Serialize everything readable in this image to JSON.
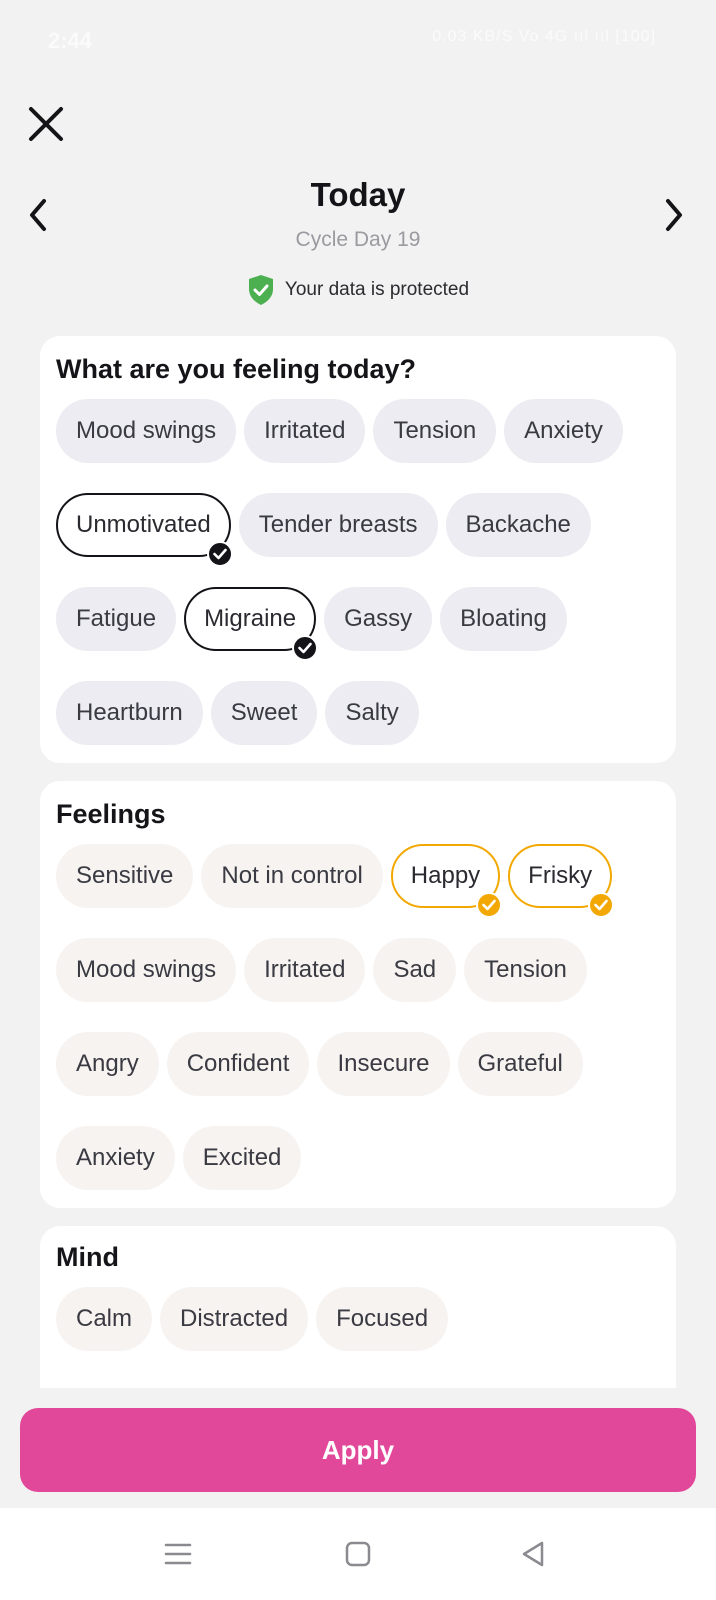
{
  "status_bar": {
    "time": "2:44",
    "icons_text": "0.03 KB/S  Vo  4G  ııl  ııl  [100]"
  },
  "header": {
    "title": "Today",
    "subtitle": "Cycle Day 19",
    "protected_text": "Your data is protected"
  },
  "symptoms": {
    "title": "What are you feeling today?",
    "chips": [
      {
        "label": "Mood swings",
        "selected": false
      },
      {
        "label": "Irritated",
        "selected": false
      },
      {
        "label": "Tension",
        "selected": false
      },
      {
        "label": "Anxiety",
        "selected": false
      },
      {
        "label": "Unmotivated",
        "selected": true
      },
      {
        "label": "Tender breasts",
        "selected": false
      },
      {
        "label": "Backache",
        "selected": false
      },
      {
        "label": "Fatigue",
        "selected": false
      },
      {
        "label": "Migraine",
        "selected": true
      },
      {
        "label": "Gassy",
        "selected": false
      },
      {
        "label": "Bloating",
        "selected": false
      },
      {
        "label": "Heartburn",
        "selected": false
      },
      {
        "label": "Sweet",
        "selected": false
      },
      {
        "label": "Salty",
        "selected": false
      }
    ]
  },
  "feelings": {
    "title": "Feelings",
    "chips": [
      {
        "label": "Sensitive",
        "selected": false
      },
      {
        "label": "Not in control",
        "selected": false
      },
      {
        "label": "Happy",
        "selected": true
      },
      {
        "label": "Frisky",
        "selected": true
      },
      {
        "label": "Mood swings",
        "selected": false
      },
      {
        "label": "Irritated",
        "selected": false
      },
      {
        "label": "Sad",
        "selected": false
      },
      {
        "label": "Tension",
        "selected": false
      },
      {
        "label": "Angry",
        "selected": false
      },
      {
        "label": "Confident",
        "selected": false
      },
      {
        "label": "Insecure",
        "selected": false
      },
      {
        "label": "Grateful",
        "selected": false
      },
      {
        "label": "Anxiety",
        "selected": false
      },
      {
        "label": "Excited",
        "selected": false
      }
    ]
  },
  "mind": {
    "title": "Mind",
    "chips": [
      {
        "label": "Calm"
      },
      {
        "label": "Distracted"
      },
      {
        "label": "Focused"
      }
    ]
  },
  "apply_label": "Apply",
  "colors": {
    "accent_pink": "#e2489a",
    "selected_orange": "#f2a800",
    "selected_black": "#141418",
    "shield_green": "#4caf50"
  },
  "icons": {
    "close": "close-icon",
    "prev": "chevron-left-icon",
    "next": "chevron-right-icon",
    "shield": "shield-check-icon",
    "nav_menu": "menu-icon",
    "nav_home": "square-home-icon",
    "nav_back": "triangle-back-icon"
  }
}
